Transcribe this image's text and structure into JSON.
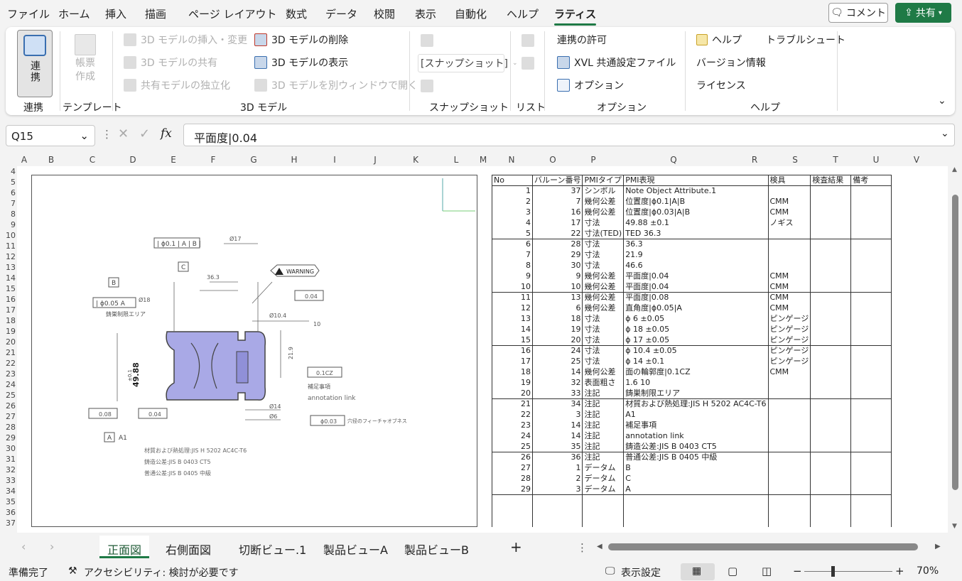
{
  "menu": {
    "tabs": [
      "ファイル",
      "ホーム",
      "挿入",
      "描画",
      "ページ レイアウト",
      "数式",
      "データ",
      "校閲",
      "表示",
      "自動化",
      "ヘルプ",
      "ラティス"
    ],
    "active": "ラティス",
    "comment": "コメント",
    "share": "共有"
  },
  "ribbon": {
    "link": "連携",
    "link_group": "連携",
    "template_btn": "帳票作成",
    "template_group": "テンプレート",
    "model": {
      "insert": "3D モデルの挿入・変更",
      "share": "3D モデルの共有",
      "independent": "共有モデルの独立化",
      "delete": "3D モデルの削除",
      "show": "3D モデルの表示",
      "open_window": "3D モデルを別ウィンドウで開く",
      "group": "3D モデル"
    },
    "snapshot": {
      "select": "[スナップショット]",
      "group": "スナップショット"
    },
    "list_group": "リスト",
    "option": {
      "permit": "連携の許可",
      "xvl": "XVL 共通設定ファイル",
      "option": "オプション",
      "group": "オプション"
    },
    "help": {
      "help": "ヘルプ",
      "trouble": "トラブルシュート",
      "version": "バージョン情報",
      "license": "ライセンス",
      "group": "ヘルプ"
    }
  },
  "formula": {
    "cell": "Q15",
    "value": "平面度|0.04",
    "fx": "fx"
  },
  "columns": [
    "A",
    "B",
    "C",
    "D",
    "E",
    "F",
    "G",
    "H",
    "I",
    "J",
    "K",
    "L",
    "M",
    "N",
    "O",
    "P",
    "Q",
    "R",
    "S",
    "T",
    "U",
    "V"
  ],
  "rows": [
    "4",
    "5",
    "6",
    "7",
    "8",
    "9",
    "10",
    "11",
    "12",
    "13",
    "14",
    "15",
    "16",
    "17",
    "18",
    "19",
    "20",
    "21",
    "22",
    "23",
    "24",
    "25",
    "26",
    "27",
    "28",
    "29",
    "30",
    "31",
    "32",
    "33",
    "34",
    "35",
    "36",
    "37"
  ],
  "pmi": {
    "headers": [
      "No",
      "バルーン番号",
      "PMIタイプ",
      "PMI表現",
      "検具",
      "検査結果",
      "備考"
    ],
    "rows": [
      [
        "1",
        "37",
        "シンボル",
        "Note Object Attribute.1",
        ""
      ],
      [
        "2",
        "7",
        "幾何公差",
        "位置度|ϕ0.1|A|B",
        "CMM"
      ],
      [
        "3",
        "16",
        "幾何公差",
        "位置度|ϕ0.03|A|B",
        "CMM"
      ],
      [
        "4",
        "17",
        "寸法",
        "49.88 ±0.1",
        "ノギス"
      ],
      [
        "5",
        "22",
        "寸法(TED)",
        "TED 36.3",
        ""
      ],
      [
        "6",
        "28",
        "寸法",
        "36.3",
        ""
      ],
      [
        "7",
        "29",
        "寸法",
        "21.9",
        ""
      ],
      [
        "8",
        "30",
        "寸法",
        "46.6",
        ""
      ],
      [
        "9",
        "9",
        "幾何公差",
        "平面度|0.04",
        "CMM"
      ],
      [
        "10",
        "10",
        "幾何公差",
        "平面度|0.04",
        "CMM"
      ],
      [
        "11",
        "13",
        "幾何公差",
        "平面度|0.08",
        "CMM"
      ],
      [
        "12",
        "6",
        "幾何公差",
        "直角度|ϕ0.05|A",
        "CMM"
      ],
      [
        "13",
        "18",
        "寸法",
        "ϕ 6 ±0.05",
        "ピンゲージ"
      ],
      [
        "14",
        "19",
        "寸法",
        "ϕ 18 ±0.05",
        "ピンゲージ"
      ],
      [
        "15",
        "20",
        "寸法",
        "ϕ 17 ±0.05",
        "ピンゲージ"
      ],
      [
        "16",
        "24",
        "寸法",
        "ϕ 10.4 ±0.05",
        "ピンゲージ"
      ],
      [
        "17",
        "25",
        "寸法",
        "ϕ 14 ±0.1",
        "ピンゲージ"
      ],
      [
        "18",
        "14",
        "幾何公差",
        "面の輪郭度|0.1CZ",
        "CMM"
      ],
      [
        "19",
        "32",
        "表面粗さ",
        "1.6 10",
        ""
      ],
      [
        "20",
        "33",
        "注記",
        "鋳巣制限エリア",
        ""
      ],
      [
        "21",
        "34",
        "注記",
        "材質および熱処理:JIS H 5202 AC4C-T6",
        ""
      ],
      [
        "22",
        "3",
        "注記",
        " A1",
        ""
      ],
      [
        "23",
        "14",
        "注記",
        "補足事項",
        ""
      ],
      [
        "24",
        "14",
        "注記",
        "annotation link",
        ""
      ],
      [
        "25",
        "35",
        "注記",
        "鋳造公差:JIS B 0403 CT5",
        ""
      ],
      [
        "26",
        "36",
        "注記",
        "普通公差:JIS B 0405 中級",
        ""
      ],
      [
        "27",
        "1",
        "データム",
        "B",
        ""
      ],
      [
        "28",
        "2",
        "データム",
        "C",
        ""
      ],
      [
        "29",
        "3",
        "データム",
        "A",
        ""
      ]
    ]
  },
  "drawing": {
    "warning": "WARNING",
    "dim_49": "49.88",
    "dim_49_tol": "±0.1",
    "dim_17": "Ø17",
    "dim_36": "36.3",
    "dim_21": "21.9",
    "dim_10_4": "Ø10.4",
    "dim_18": "Ø18",
    "dim_14": "Ø14",
    "dim_6": "Ø6",
    "fcf1": "| ϕ0.1 | A | B |",
    "fcf2": "| ϕ0.05 A",
    "fcf3": "ϕ0.03",
    "flat1": "0.04",
    "flat2": "0.08",
    "flat3": "0.04",
    "profile": "0.1CZ",
    "rough": "10",
    "datum_a": "A",
    "datum_b": "B",
    "datum_c": "C",
    "a1": "A1",
    "area": "鋳巣制限エリア",
    "supp": "補足事項",
    "annot": "annotation link",
    "feature": "穴径のフィーチャオブネス",
    "note1": "材質および熱処理:JIS H 5202 AC4C-T6",
    "note2": "鋳造公差:JIS B 0403 CT5",
    "note3": "普通公差:JIS B 0405 中級"
  },
  "sheets": {
    "tabs": [
      "正面図",
      "右側面図",
      "切断ビュー.1",
      "製品ビューA",
      "製品ビューB"
    ],
    "active": "正面図",
    "add": "+"
  },
  "status": {
    "ready": "準備完了",
    "access": "アクセシビリティ: 検討が必要です",
    "display": "表示設定",
    "zoom": "70%"
  }
}
